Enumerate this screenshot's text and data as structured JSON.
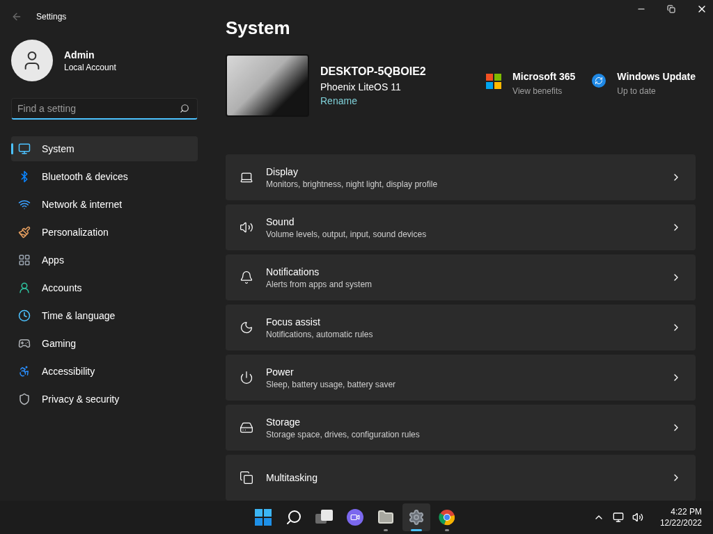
{
  "window": {
    "title": "Settings"
  },
  "account": {
    "name": "Admin",
    "type": "Local Account"
  },
  "search": {
    "placeholder": "Find a setting"
  },
  "sidebar": {
    "items": [
      {
        "label": "System",
        "kind": "system",
        "selected": true
      },
      {
        "label": "Bluetooth & devices",
        "kind": "bluetooth",
        "selected": false
      },
      {
        "label": "Network & internet",
        "kind": "network",
        "selected": false
      },
      {
        "label": "Personalization",
        "kind": "brush",
        "selected": false
      },
      {
        "label": "Apps",
        "kind": "apps",
        "selected": false
      },
      {
        "label": "Accounts",
        "kind": "accounts",
        "selected": false
      },
      {
        "label": "Time & language",
        "kind": "time",
        "selected": false
      },
      {
        "label": "Gaming",
        "kind": "gaming",
        "selected": false
      },
      {
        "label": "Accessibility",
        "kind": "accessibility",
        "selected": false
      },
      {
        "label": "Privacy & security",
        "kind": "privacy",
        "selected": false
      }
    ]
  },
  "page": {
    "title": "System",
    "device": {
      "name": "DESKTOP-5QBOIE2",
      "os": "Phoenix LiteOS 11",
      "rename": "Rename"
    },
    "tiles": [
      {
        "kind": "office",
        "title": "Microsoft 365",
        "subtitle": "View benefits"
      },
      {
        "kind": "update",
        "title": "Windows Update",
        "subtitle": "Up to date"
      }
    ],
    "cards": [
      {
        "kind": "display",
        "title": "Display",
        "subtitle": "Monitors, brightness, night light, display profile"
      },
      {
        "kind": "sound",
        "title": "Sound",
        "subtitle": "Volume levels, output, input, sound devices"
      },
      {
        "kind": "notifications",
        "title": "Notifications",
        "subtitle": "Alerts from apps and system"
      },
      {
        "kind": "focus",
        "title": "Focus assist",
        "subtitle": "Notifications, automatic rules"
      },
      {
        "kind": "power",
        "title": "Power",
        "subtitle": "Sleep, battery usage, battery saver"
      },
      {
        "kind": "storage",
        "title": "Storage",
        "subtitle": "Storage space, drives, configuration rules"
      },
      {
        "kind": "multitasking",
        "title": "Multitasking"
      }
    ]
  },
  "taskbar": {
    "apps": [
      {
        "kind": "start",
        "running": false,
        "selected": false
      },
      {
        "kind": "search",
        "running": false,
        "selected": false
      },
      {
        "kind": "taskview",
        "running": false,
        "selected": false
      },
      {
        "kind": "chat",
        "running": false,
        "selected": false
      },
      {
        "kind": "files",
        "running": true,
        "selected": false
      },
      {
        "kind": "settings",
        "running": true,
        "selected": true
      },
      {
        "kind": "browser",
        "running": true,
        "selected": false
      }
    ],
    "time": "4:22 PM",
    "date": "12/22/2022"
  }
}
